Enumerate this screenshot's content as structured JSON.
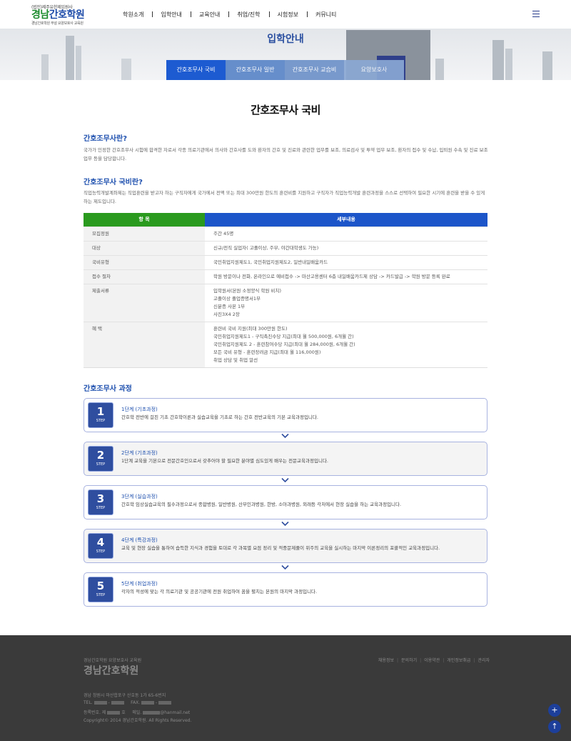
{
  "header": {
    "logo_line1": "(법인)제주유한제임원사",
    "logo_name_green": "경남",
    "logo_name_blue": "간호학원",
    "logo_line3": "경남간호학원 부설 요양보호사 교육원",
    "nav": [
      "학원소개",
      "입학안내",
      "교육안내",
      "취업/진학",
      "시험정보",
      "커뮤니티"
    ]
  },
  "banner": {
    "title": "입학안내",
    "tabs": [
      "간호조무사 국비",
      "간호조무사 일반",
      "간호조무사 교습비",
      "요양보호사"
    ]
  },
  "page_title": "간호조무사 국비",
  "section1": {
    "heading": "간호조무사란?",
    "text": "국가가 인정한 간호조무사 시험에 합격한 자로서 각종 의료기관에서 의사와 간호사를 도와 환자의 간호 및 진료와 관련한 업무를 보조, 의료검사 및 투약 업무 보조, 환자의 접수 및 수납, 입퇴원 수속 및 진료 보조 업무 등을 담당합니다."
  },
  "section2": {
    "heading": "간호조무사 국비란?",
    "text": "직업능력개발계좌제는 직업훈련을 받고자 하는 구직자에게 국가에서 전액 또는 최대 300만원 한도의 훈련비를 지원하고 구직자가 직업능력개발 훈련과정을 스스로 선택하여 필요한 시기에 훈련을 받을 수 있게 하는 제도입니다."
  },
  "table": {
    "header": [
      "항 목",
      "세부내용"
    ],
    "rows": [
      {
        "label": "모집정원",
        "lines": [
          "주간 45명"
        ]
      },
      {
        "label": "대상",
        "lines": [
          "신규/전직 실업자( 고졸이상, 주부, 야간대학생도 가능)"
        ]
      },
      {
        "label": "국비유형",
        "lines": [
          "국민취업지원제도1, 국민취업지원제도2, 일반내일배움카드"
        ]
      },
      {
        "label": "접수 절차",
        "lines": [
          "학원 방문이나 전화, 온라인으로 예비접수 -> 마산고용센터 6층 내일배움카드제 상담 -> 카드발급 -> 학원 방문 등록 완료"
        ]
      },
      {
        "label": "제출서류",
        "lines": [
          "입학원서(본원 소정양식 학원 비치)",
          "고졸이상 졸업증명서1부",
          "신분증 사본 1부",
          "사진3X4 2장"
        ]
      },
      {
        "label": "혜 택",
        "lines": [
          "훈련비 국비 지원(최대 300만원 한도)",
          "국민취업지원제도1 - 구직촉진수당 지급(최대 월 500,000원, 6개월 간)",
          "국민취업지원제도 2 - 훈련참여수당 지급(최대 월 284,000원, 6개월 간)",
          "모든 국비 유형 - 훈련장려금 지급(최대 월 116,000원)",
          "취업 상담 및 취업 알선"
        ]
      }
    ]
  },
  "course": {
    "heading": "간호조무사 과정",
    "step_label": "STEP",
    "steps": [
      {
        "num": "1",
        "title": "1단계 (기초과정)",
        "desc": "간호학 전반에 걸친 기초 간호학이론과 실습교육을 기초로 하는 간호 전반교육의 기본 교육과정입니다."
      },
      {
        "num": "2",
        "title": "2단계 (기초과정)",
        "desc": "1단계 교육을 기본으로 전문간호인으로서 갖추어야 할 필요한 분야별 심도있게 배우는 전문교육과정입니다."
      },
      {
        "num": "3",
        "title": "3단계 (실습과정)",
        "desc": "간호학 임상실습교육의 필수과정으로서 종합병원, 일반병원, 산부인과병원, 한방, 소아과병원, 외래등 각처에서 현장 실습을 하는 교육과정입니다."
      },
      {
        "num": "4",
        "title": "4단계 (특강과정)",
        "desc": "교육 및 현장 실습을 통하여 습득한 지식과 경험을 토대로 각 과목별 요점 정리 및 적중문제풀이 위주의 교육을 실시하는 마지막 이론정리의 포괄적인 교육과정입니다."
      },
      {
        "num": "5",
        "title": "5단계 (취업과정)",
        "desc": "각자의 적성에 맞는 각 의료기관 및 공공기관에 전원 취업하여 꿈을 펼치는 본원의 마지막 과정입니다."
      }
    ]
  },
  "footer": {
    "small": "경남간호학원 요양보호사 교육원",
    "name": "경남간호학원",
    "links": [
      "채용정보",
      "문의하기",
      "이용약관",
      "개인정보취급",
      "관리자"
    ],
    "address": "경남 창원시 마산합포구 산호동 1가 65-6번지",
    "tel_label": "TEL.",
    "fax_label": "FAX.",
    "reg_label": "등록번호. 제",
    "reg_suffix": "호",
    "email_label": "메일.",
    "email_domain": "@hanmail.net",
    "copyright": "Copyright© 2014 경남간호학원. All Rights Reserved."
  },
  "fab": {
    "plus": "+",
    "up": "↑"
  }
}
